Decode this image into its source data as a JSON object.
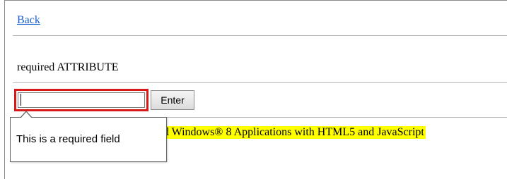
{
  "nav": {
    "back_label": "Back"
  },
  "section": {
    "heading": "required ATTRIBUTE"
  },
  "form": {
    "input_value": "",
    "enter_label": "Enter"
  },
  "validation": {
    "message": "This is a required field"
  },
  "footer": {
    "text_visible": "ild Windows® 8 Applications with HTML5 and JavaScript"
  },
  "colors": {
    "link": "#1a5fcf",
    "invalid_border": "#d61a1a",
    "highlight": "#ffff00"
  }
}
